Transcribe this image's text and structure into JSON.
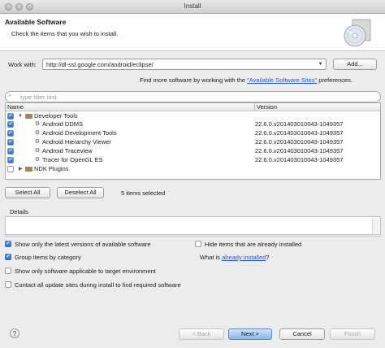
{
  "window": {
    "title": "Install"
  },
  "header": {
    "title": "Available Software",
    "description": "Check the items that you wish to install."
  },
  "work_with": {
    "label": "Work with:",
    "value": "http://dl-ssl.google.com/android/eclipse/",
    "add_button": "Add...",
    "more_prefix": "Find more software by working with the ",
    "more_link": "\"Available Software Sites\"",
    "more_suffix": " preferences."
  },
  "filter": {
    "placeholder": "type filter text"
  },
  "table": {
    "columns": [
      "Name",
      "Version"
    ],
    "rows": [
      {
        "name": "Developer Tools",
        "version": "",
        "checked": true,
        "level": 0,
        "expanded": true,
        "icon": "folder-icon"
      },
      {
        "name": "Android DDMS",
        "version": "22.6.0.v201403010043-1049357",
        "checked": true,
        "level": 1,
        "icon": "plugin-icon"
      },
      {
        "name": "Android Development Tools",
        "version": "22.6.0.v201403010043-1049357",
        "checked": true,
        "level": 1,
        "icon": "plugin-icon"
      },
      {
        "name": "Android Hierarchy Viewer",
        "version": "22.6.0.v201403010043-1049357",
        "checked": true,
        "level": 1,
        "icon": "plugin-icon"
      },
      {
        "name": "Android Traceview",
        "version": "22.6.0.v201403010043-1049357",
        "checked": true,
        "level": 1,
        "icon": "plugin-icon"
      },
      {
        "name": "Tracer for OpenGL ES",
        "version": "22.6.0.v201403010043-1049357",
        "checked": true,
        "level": 1,
        "icon": "plugin-icon"
      },
      {
        "name": "NDK Plugins",
        "version": "",
        "checked": false,
        "level": 0,
        "expanded": false,
        "icon": "folder-icon"
      }
    ]
  },
  "selection": {
    "select_all": "Select All",
    "deselect_all": "Deselect All",
    "count_text": "5 items selected"
  },
  "details": {
    "label": "Details"
  },
  "options": {
    "latest_only": {
      "label": "Show only the latest versions of available software",
      "checked": true
    },
    "hide_installed": {
      "label": "Hide items that are already installed",
      "checked": false
    },
    "group_by_category": {
      "label": "Group items by category",
      "checked": true
    },
    "what_is_prefix": "What is ",
    "what_is_link": "already installed",
    "what_is_suffix": "?",
    "target_env": {
      "label": "Show only software applicable to target environment",
      "checked": false
    },
    "contact_all": {
      "label": "Contact all update sites during install to find required software",
      "checked": false
    }
  },
  "footer": {
    "help_label": "?",
    "back": "< Back",
    "next": "Next >",
    "cancel": "Cancel",
    "finish": "Finish"
  },
  "colors": {
    "accent": "#2a6fd0",
    "link": "#2a56c6"
  }
}
